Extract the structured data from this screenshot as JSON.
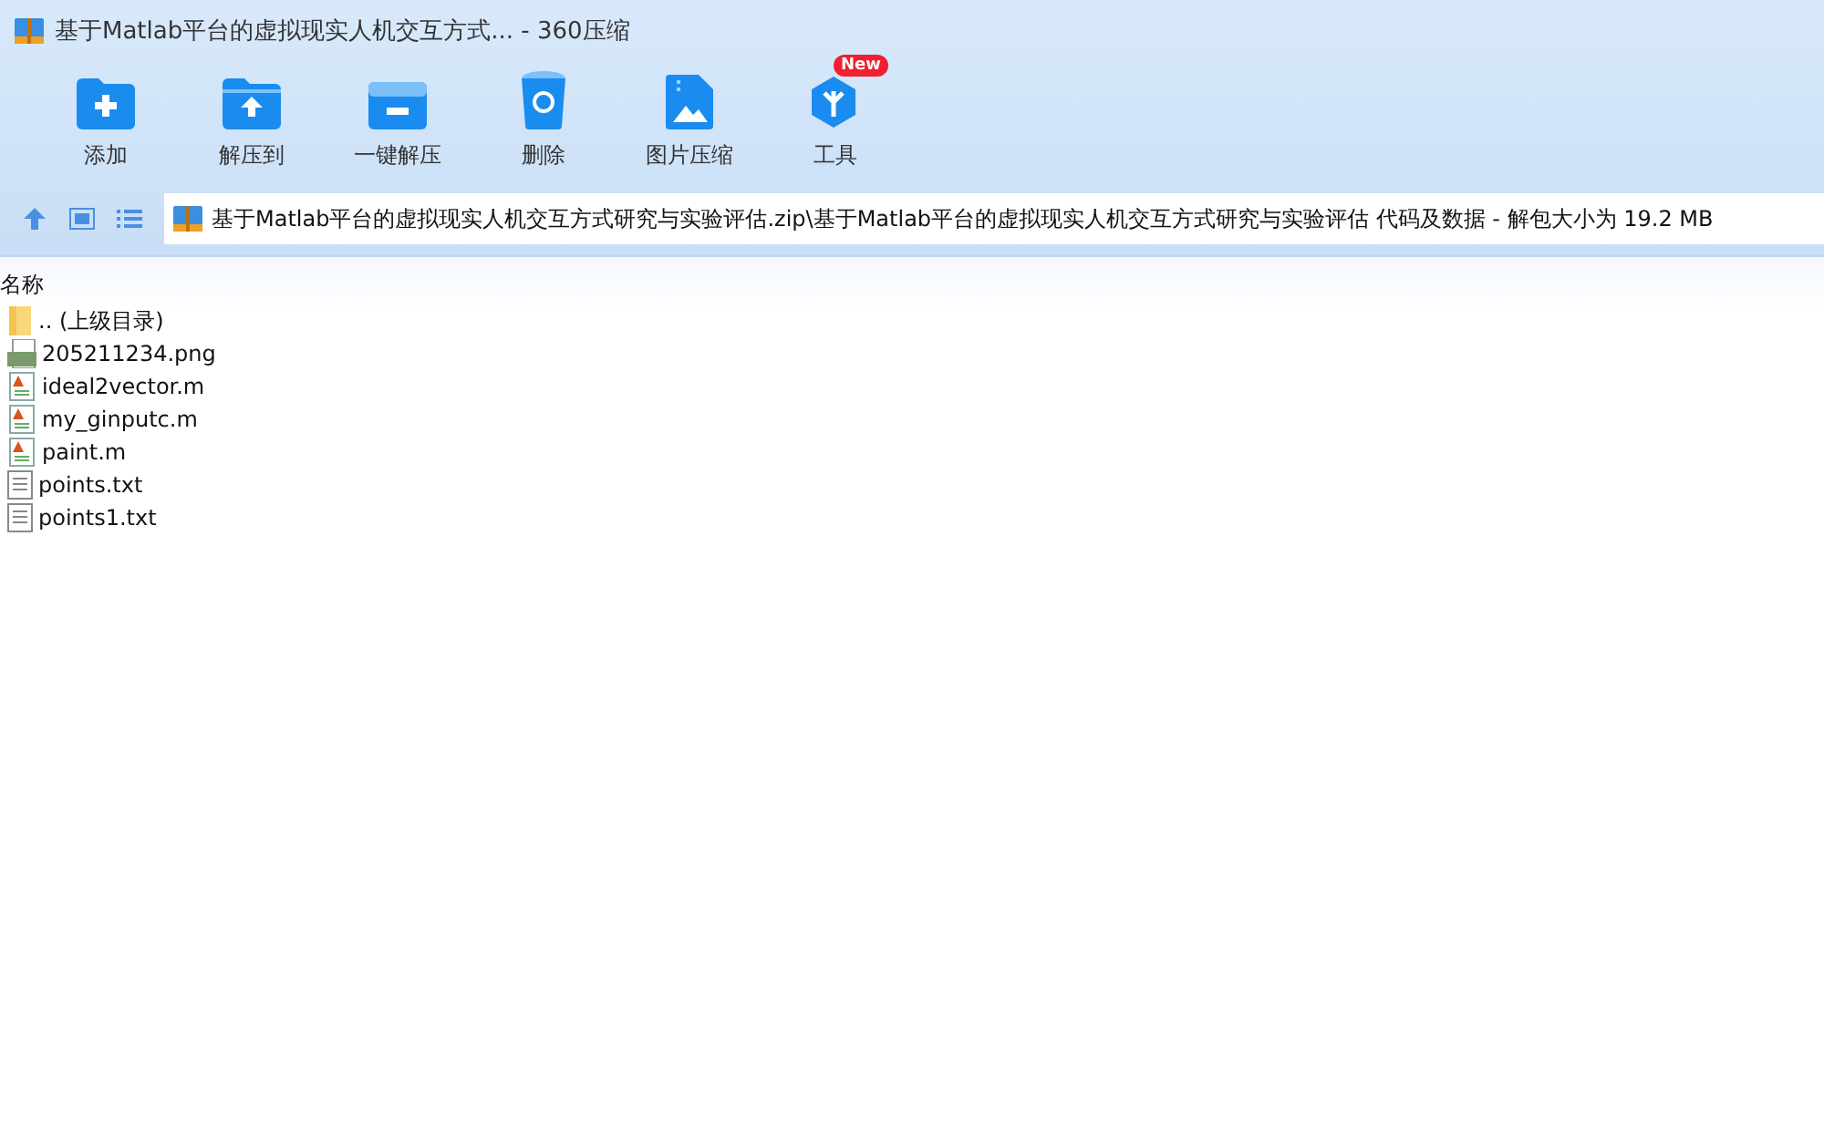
{
  "window": {
    "title": "基于Matlab平台的虚拟现实人机交互方式... - 360压缩"
  },
  "toolbar": [
    {
      "label": "添加",
      "kind": "add"
    },
    {
      "label": "解压到",
      "kind": "extract"
    },
    {
      "label": "一键解压",
      "kind": "quick"
    },
    {
      "label": "删除",
      "kind": "delete"
    },
    {
      "label": "图片压缩",
      "kind": "image"
    },
    {
      "label": "工具",
      "kind": "tools",
      "badge": "New"
    }
  ],
  "address": {
    "path": "基于Matlab平台的虚拟现实人机交互方式研究与实验评估.zip\\基于Matlab平台的虚拟现实人机交互方式研究与实验评估 代码及数据 - 解包大小为 19.2 MB"
  },
  "file_list": {
    "columns": [
      "名称"
    ],
    "rows": [
      {
        "name": ".. (上级目录)",
        "kind": "folder"
      },
      {
        "name": "205211234.png",
        "kind": "png"
      },
      {
        "name": "ideal2vector.m",
        "kind": "m"
      },
      {
        "name": "my_ginputc.m",
        "kind": "m"
      },
      {
        "name": "paint.m",
        "kind": "m"
      },
      {
        "name": "points.txt",
        "kind": "txt"
      },
      {
        "name": "points1.txt",
        "kind": "txt"
      }
    ]
  }
}
